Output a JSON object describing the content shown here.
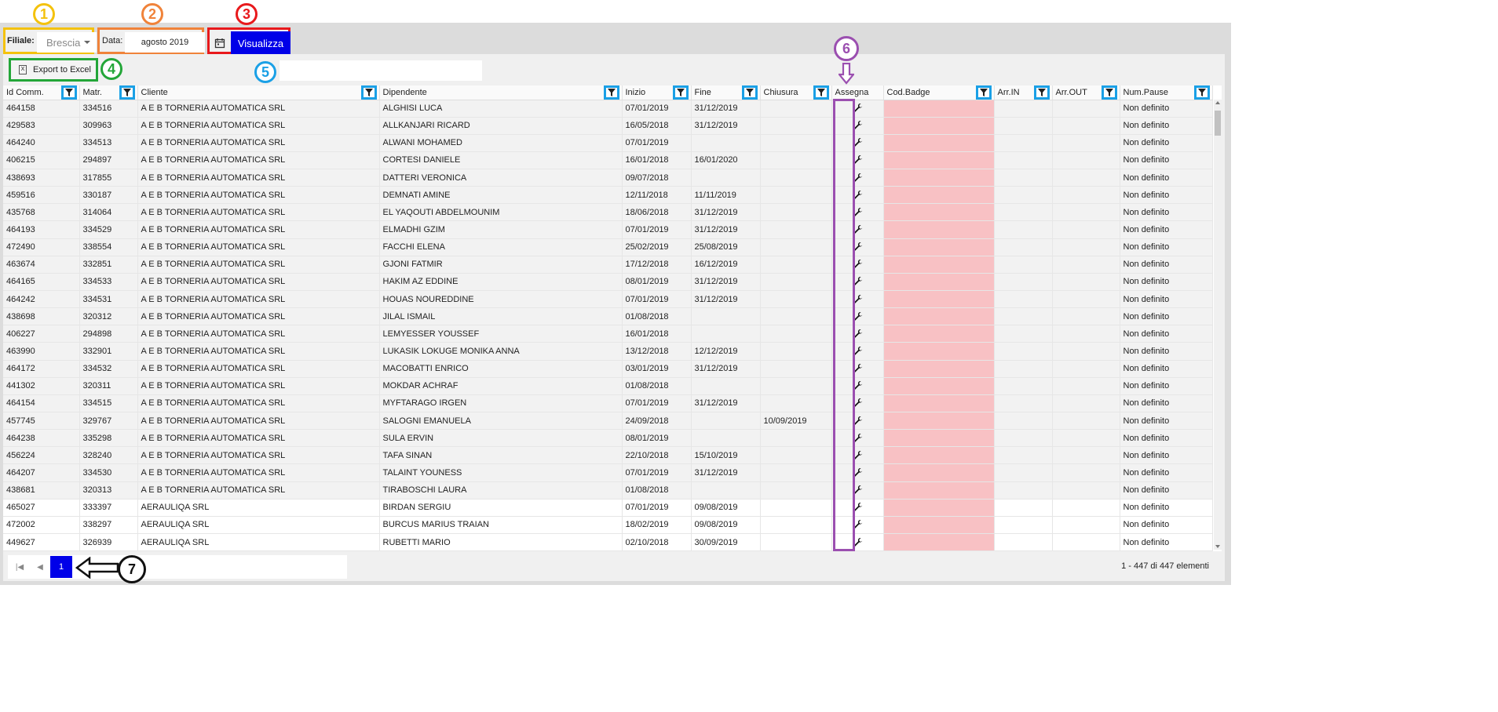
{
  "toolbar": {
    "branch_label": "Filiale:",
    "branch_value": "Brescia",
    "date_label": "Data:",
    "date_value": "agosto 2019",
    "view_button": "Visualizza"
  },
  "panel": {
    "export_button": "Export to Excel"
  },
  "annotations": [
    "1",
    "2",
    "3",
    "4",
    "5",
    "6",
    "7"
  ],
  "table": {
    "columns": [
      "Id Comm.",
      "Matr.",
      "Cliente",
      "Dipendente",
      "Inizio",
      "Fine",
      "Chiusura",
      "Assegna",
      "Cod.Badge",
      "Arr.IN",
      "Arr.OUT",
      "Num.Pause"
    ],
    "rows": [
      [
        "464158",
        "334516",
        "A E B TORNERIA AUTOMATICA SRL",
        "ALGHISI LUCA",
        "07/01/2019",
        "31/12/2019",
        "",
        "",
        "",
        "",
        "",
        "Non definito"
      ],
      [
        "429583",
        "309963",
        "A E B TORNERIA AUTOMATICA SRL",
        "ALLKANJARI RICARD",
        "16/05/2018",
        "31/12/2019",
        "",
        "",
        "",
        "",
        "",
        "Non definito"
      ],
      [
        "464240",
        "334513",
        "A E B TORNERIA AUTOMATICA SRL",
        "ALWANI MOHAMED",
        "07/01/2019",
        "",
        "",
        "",
        "",
        "",
        "",
        "Non definito"
      ],
      [
        "406215",
        "294897",
        "A E B TORNERIA AUTOMATICA SRL",
        "CORTESI DANIELE",
        "16/01/2018",
        "16/01/2020",
        "",
        "",
        "",
        "",
        "",
        "Non definito"
      ],
      [
        "438693",
        "317855",
        "A E B TORNERIA AUTOMATICA SRL",
        "DATTERI VERONICA",
        "09/07/2018",
        "",
        "",
        "",
        "",
        "",
        "",
        "Non definito"
      ],
      [
        "459516",
        "330187",
        "A E B TORNERIA AUTOMATICA SRL",
        "DEMNATI AMINE",
        "12/11/2018",
        "11/11/2019",
        "",
        "",
        "",
        "",
        "",
        "Non definito"
      ],
      [
        "435768",
        "314064",
        "A E B TORNERIA AUTOMATICA SRL",
        "EL YAQOUTI ABDELMOUNIM",
        "18/06/2018",
        "31/12/2019",
        "",
        "",
        "",
        "",
        "",
        "Non definito"
      ],
      [
        "464193",
        "334529",
        "A E B TORNERIA AUTOMATICA SRL",
        "ELMADHI GZIM",
        "07/01/2019",
        "31/12/2019",
        "",
        "",
        "",
        "",
        "",
        "Non definito"
      ],
      [
        "472490",
        "338554",
        "A E B TORNERIA AUTOMATICA SRL",
        "FACCHI ELENA",
        "25/02/2019",
        "25/08/2019",
        "",
        "",
        "",
        "",
        "",
        "Non definito"
      ],
      [
        "463674",
        "332851",
        "A E B TORNERIA AUTOMATICA SRL",
        "GJONI FATMIR",
        "17/12/2018",
        "16/12/2019",
        "",
        "",
        "",
        "",
        "",
        "Non definito"
      ],
      [
        "464165",
        "334533",
        "A E B TORNERIA AUTOMATICA SRL",
        "HAKIM AZ EDDINE",
        "08/01/2019",
        "31/12/2019",
        "",
        "",
        "",
        "",
        "",
        "Non definito"
      ],
      [
        "464242",
        "334531",
        "A E B TORNERIA AUTOMATICA SRL",
        "HOUAS NOUREDDINE",
        "07/01/2019",
        "31/12/2019",
        "",
        "",
        "",
        "",
        "",
        "Non definito"
      ],
      [
        "438698",
        "320312",
        "A E B TORNERIA AUTOMATICA SRL",
        "JILAL ISMAIL",
        "01/08/2018",
        "",
        "",
        "",
        "",
        "",
        "",
        "Non definito"
      ],
      [
        "406227",
        "294898",
        "A E B TORNERIA AUTOMATICA SRL",
        "LEMYESSER YOUSSEF",
        "16/01/2018",
        "",
        "",
        "",
        "",
        "",
        "",
        "Non definito"
      ],
      [
        "463990",
        "332901",
        "A E B TORNERIA AUTOMATICA SRL",
        "LUKASIK LOKUGE MONIKA ANNA",
        "13/12/2018",
        "12/12/2019",
        "",
        "",
        "",
        "",
        "",
        "Non definito"
      ],
      [
        "464172",
        "334532",
        "A E B TORNERIA AUTOMATICA SRL",
        "MACOBATTI ENRICO",
        "03/01/2019",
        "31/12/2019",
        "",
        "",
        "",
        "",
        "",
        "Non definito"
      ],
      [
        "441302",
        "320311",
        "A E B TORNERIA AUTOMATICA SRL",
        "MOKDAR ACHRAF",
        "01/08/2018",
        "",
        "",
        "",
        "",
        "",
        "",
        "Non definito"
      ],
      [
        "464154",
        "334515",
        "A E B TORNERIA AUTOMATICA SRL",
        "MYFTARAGO IRGEN",
        "07/01/2019",
        "31/12/2019",
        "",
        "",
        "",
        "",
        "",
        "Non definito"
      ],
      [
        "457745",
        "329767",
        "A E B TORNERIA AUTOMATICA SRL",
        "SALOGNI EMANUELA",
        "24/09/2018",
        "",
        "10/09/2019",
        "",
        "",
        "",
        "",
        "Non definito"
      ],
      [
        "464238",
        "335298",
        "A E B TORNERIA AUTOMATICA SRL",
        "SULA ERVIN",
        "08/01/2019",
        "",
        "",
        "",
        "",
        "",
        "",
        "Non definito"
      ],
      [
        "456224",
        "328240",
        "A E B TORNERIA AUTOMATICA SRL",
        "TAFA SINAN",
        "22/10/2018",
        "15/10/2019",
        "",
        "",
        "",
        "",
        "",
        "Non definito"
      ],
      [
        "464207",
        "334530",
        "A E B TORNERIA AUTOMATICA SRL",
        "TALAINT YOUNESS",
        "07/01/2019",
        "31/12/2019",
        "",
        "",
        "",
        "",
        "",
        "Non definito"
      ],
      [
        "438681",
        "320313",
        "A E B TORNERIA AUTOMATICA SRL",
        "TIRABOSCHI LAURA",
        "01/08/2018",
        "",
        "",
        "",
        "",
        "",
        "",
        "Non definito"
      ],
      [
        "465027",
        "333397",
        "AERAULIQA SRL",
        "BIRDAN SERGIU",
        "07/01/2019",
        "09/08/2019",
        "",
        "",
        "",
        "",
        "",
        "Non definito"
      ],
      [
        "472002",
        "338297",
        "AERAULIQA SRL",
        "BURCUS MARIUS TRAIAN",
        "18/02/2019",
        "09/08/2019",
        "",
        "",
        "",
        "",
        "",
        "Non definito"
      ],
      [
        "449627",
        "326939",
        "AERAULIQA SRL",
        "RUBETTI MARIO",
        "02/10/2018",
        "30/09/2019",
        "",
        "",
        "",
        "",
        "",
        "Non definito"
      ]
    ]
  },
  "pager": {
    "current_page": "1",
    "info": "1 - 447 di 447 elementi"
  },
  "colors": {
    "accent": "#0000e8",
    "badge_cell": "#f8c1c4",
    "annot_yellow": "#f4c20d",
    "annot_orange": "#f0833a",
    "annot_red": "#e8191c",
    "annot_green": "#23a638",
    "annot_blue": "#1aa0e6",
    "annot_purple": "#9b4fb0"
  },
  "icons": {
    "filter": "funnel-icon",
    "assign": "wrench-icon",
    "calendar": "calendar-icon",
    "export": "excel-icon"
  }
}
